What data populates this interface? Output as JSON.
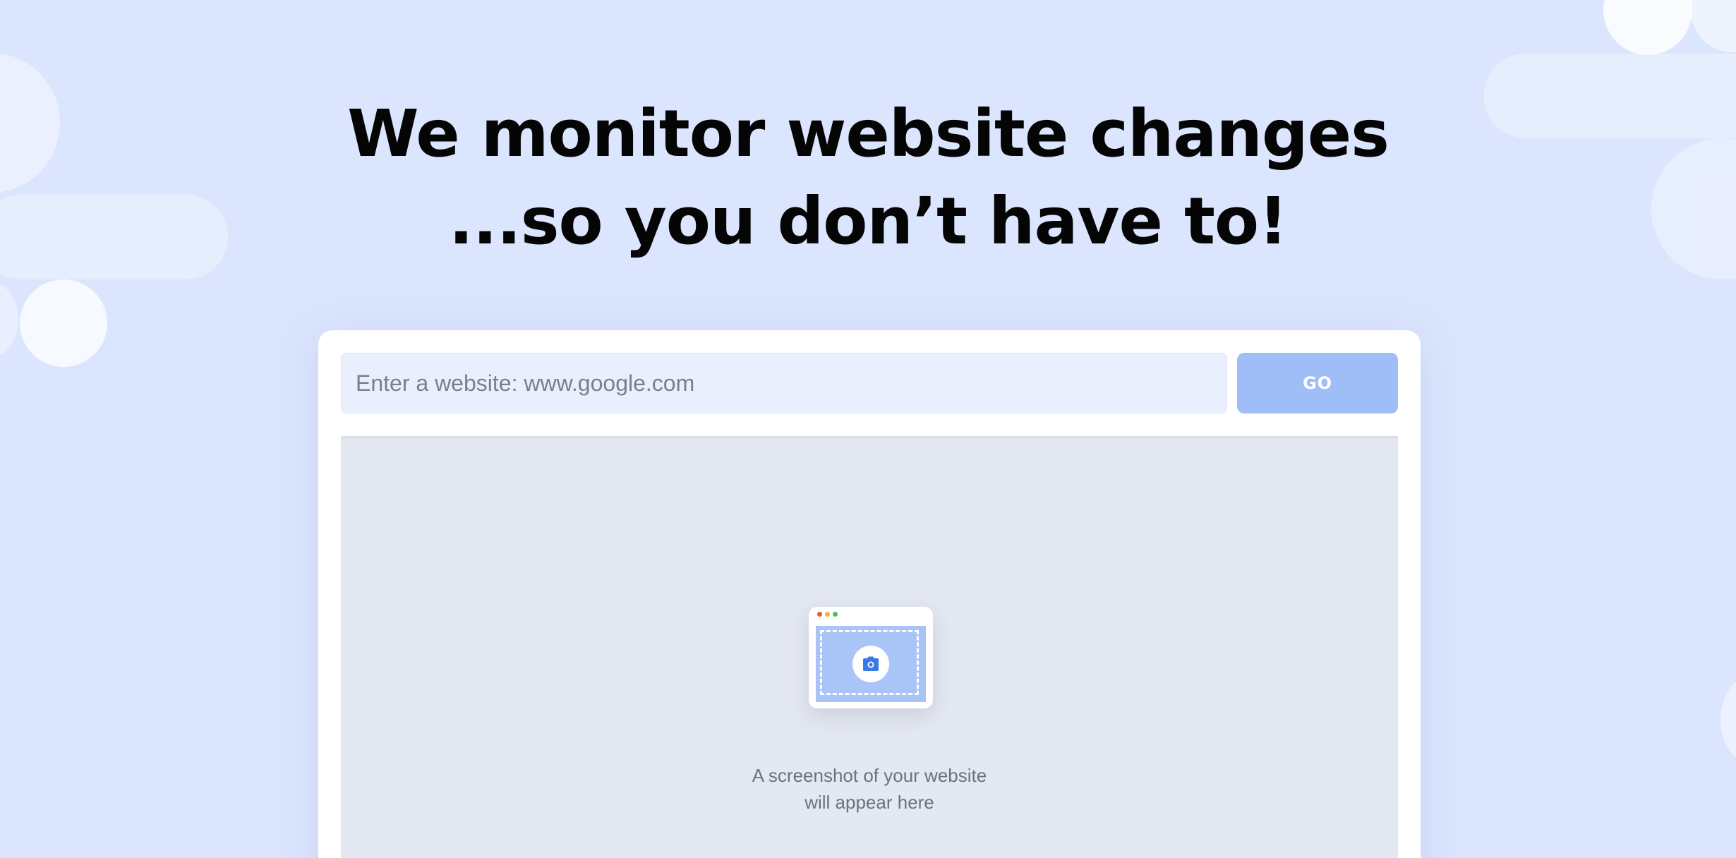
{
  "hero": {
    "headline_line1": "We monitor website changes",
    "headline_line2": "...so you don’t have to!"
  },
  "search": {
    "placeholder": "Enter a website: www.google.com",
    "value": "",
    "go_label": "GO"
  },
  "preview": {
    "caption_line1": "A screenshot of your website",
    "caption_line2": "will appear here",
    "icon": "camera-icon"
  },
  "colors": {
    "background": "#dbe5fd",
    "button": "#9fbdf7",
    "input_bg": "#e9effd",
    "preview_bg": "#e4e8f1",
    "accent_blue": "#3b78e7"
  }
}
